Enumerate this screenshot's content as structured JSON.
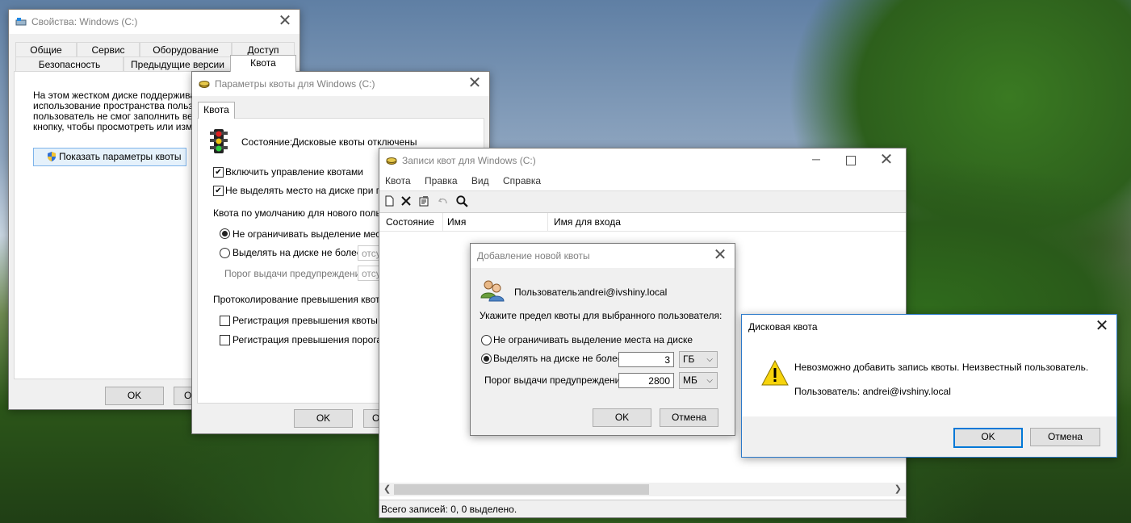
{
  "props": {
    "title": "Свойства: Windows (C:)",
    "tabs_row1": [
      "Общие",
      "Сервис",
      "Оборудование",
      "Доступ"
    ],
    "tabs_row2": [
      "Безопасность",
      "Предыдущие версии",
      "Квота"
    ],
    "text1": "На этом жестком диске поддерживаю",
    "text2": "использование пространства пользова",
    "text3": "пользователь не смог заполнить весь",
    "text4": "кнопку, чтобы просмотреть или изменн",
    "show_button": "Показать параметры квоты",
    "ok": "OK",
    "cancel_partial": "От"
  },
  "quota_settings": {
    "title": "Параметры квоты для Windows (C:)",
    "tab": "Квота",
    "status_label": "Состояние:",
    "status_value": "Дисковые квоты отключены",
    "enable_mgmt": "Включить управление квотами",
    "deny_space": "Не выделять место на диске при пре",
    "default_quota_label": "Квота по умолчанию для нового пользов",
    "no_limit": "Не ограничивать выделение места",
    "limit": "Выделять на диске не более",
    "warn_threshold": "Порог выдачи предупреждений",
    "field_placeholder": "отсу",
    "logging_label": "Протоколирование превышения квоты д",
    "log_quota": "Регистрация превышения квоты по",
    "log_warn": "Регистрация превышения порога пр",
    "ok": "OK",
    "cancel_partial": "О"
  },
  "entries": {
    "title": "Записи квот для Windows (C:)",
    "menu": [
      "Квота",
      "Правка",
      "Вид",
      "Справка"
    ],
    "columns": [
      "Состояние",
      "Имя",
      "Имя для входа"
    ],
    "status_bar": "Всего записей: 0, 0 выделено."
  },
  "add_quota": {
    "title": "Добавление новой квоты",
    "user_label": "Пользователь:",
    "user_value": "andrei@ivshiny.local",
    "prompt": "Укажите предел квоты для выбранного пользователя:",
    "no_limit": "Не ограничивать выделение места на диске",
    "limit": "Выделять на диске не более",
    "limit_value": "3",
    "limit_unit": "ГБ",
    "warn_label": "Порог выдачи предупреждений",
    "warn_value": "2800",
    "warn_unit": "МБ",
    "ok": "OK",
    "cancel": "Отмена"
  },
  "error": {
    "title": "Дисковая квота",
    "message": "Невозможно добавить запись квоты. Неизвестный пользователь.",
    "user_line": "Пользователь: andrei@ivshiny.local",
    "ok": "OK",
    "cancel": "Отмена"
  }
}
